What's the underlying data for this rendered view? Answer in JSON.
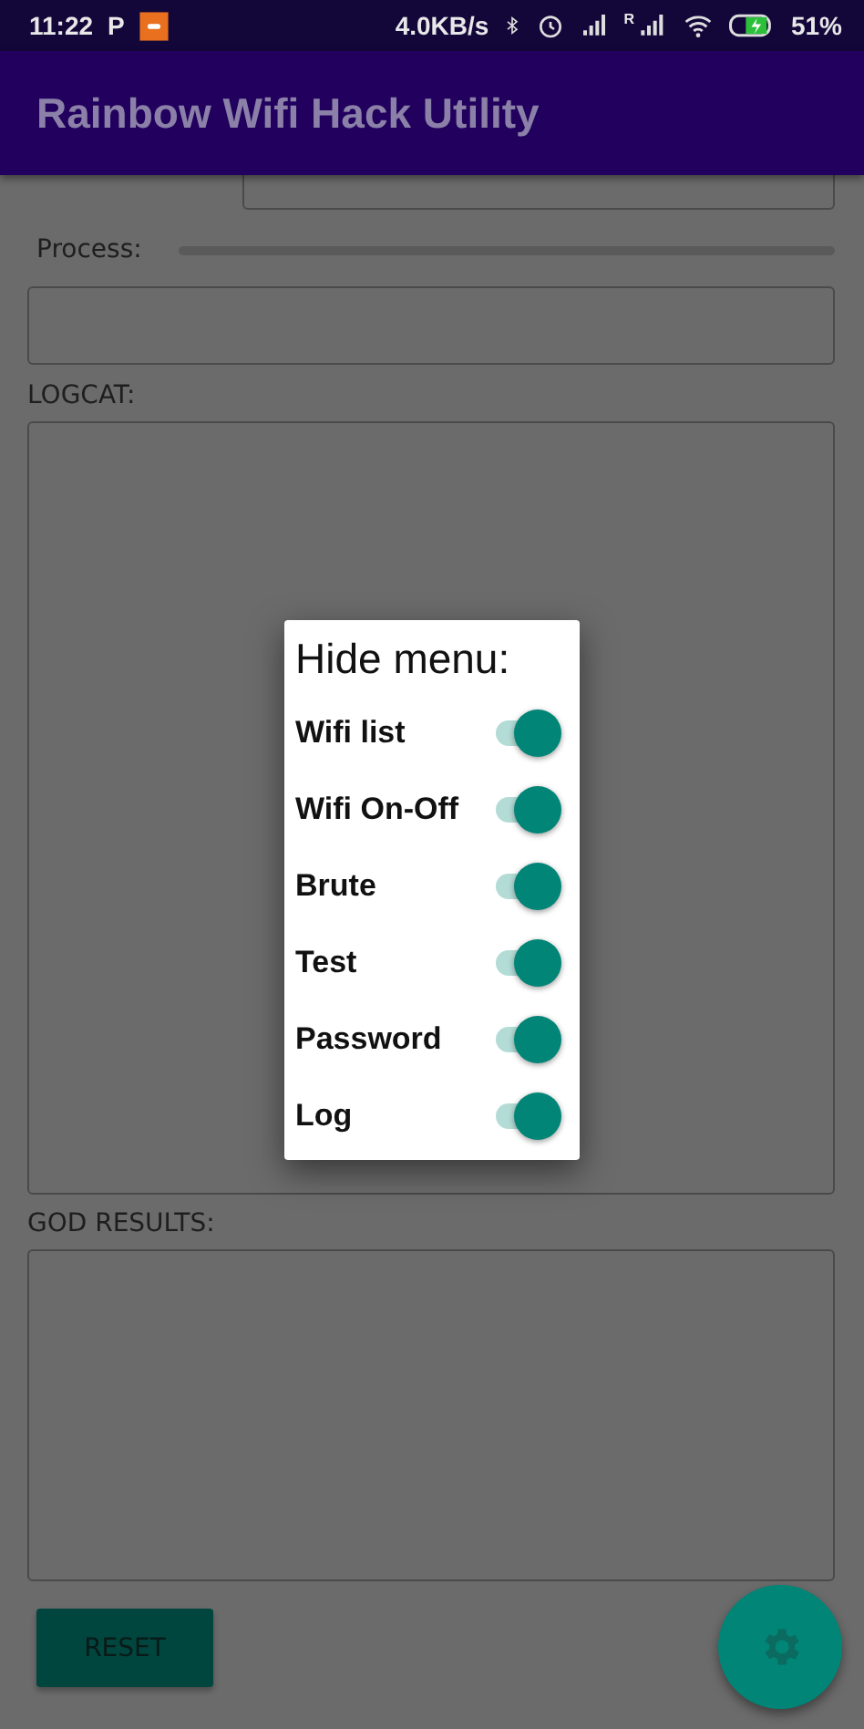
{
  "status_bar": {
    "time": "11:22",
    "notification_letter": "P",
    "speed": "4.0KB/s",
    "signal_roaming_mark": "R",
    "battery_charging": true,
    "battery": "51%"
  },
  "app_bar": {
    "title": "Rainbow Wifi Hack Utility"
  },
  "form": {
    "process_label": "Process:",
    "process": {
      "level": 0
    },
    "logcat_label": "LOGCAT:",
    "results_label": "GOD RESULTS:",
    "reset_button": "RESET"
  },
  "dialog": {
    "title": "Hide menu:",
    "items": [
      {
        "label": "Wifi list",
        "on": true
      },
      {
        "label": "Wifi On-Off",
        "on": true
      },
      {
        "label": "Brute",
        "on": true
      },
      {
        "label": "Test",
        "on": true
      },
      {
        "label": "Password",
        "on": true
      },
      {
        "label": "Log",
        "on": true
      }
    ]
  }
}
